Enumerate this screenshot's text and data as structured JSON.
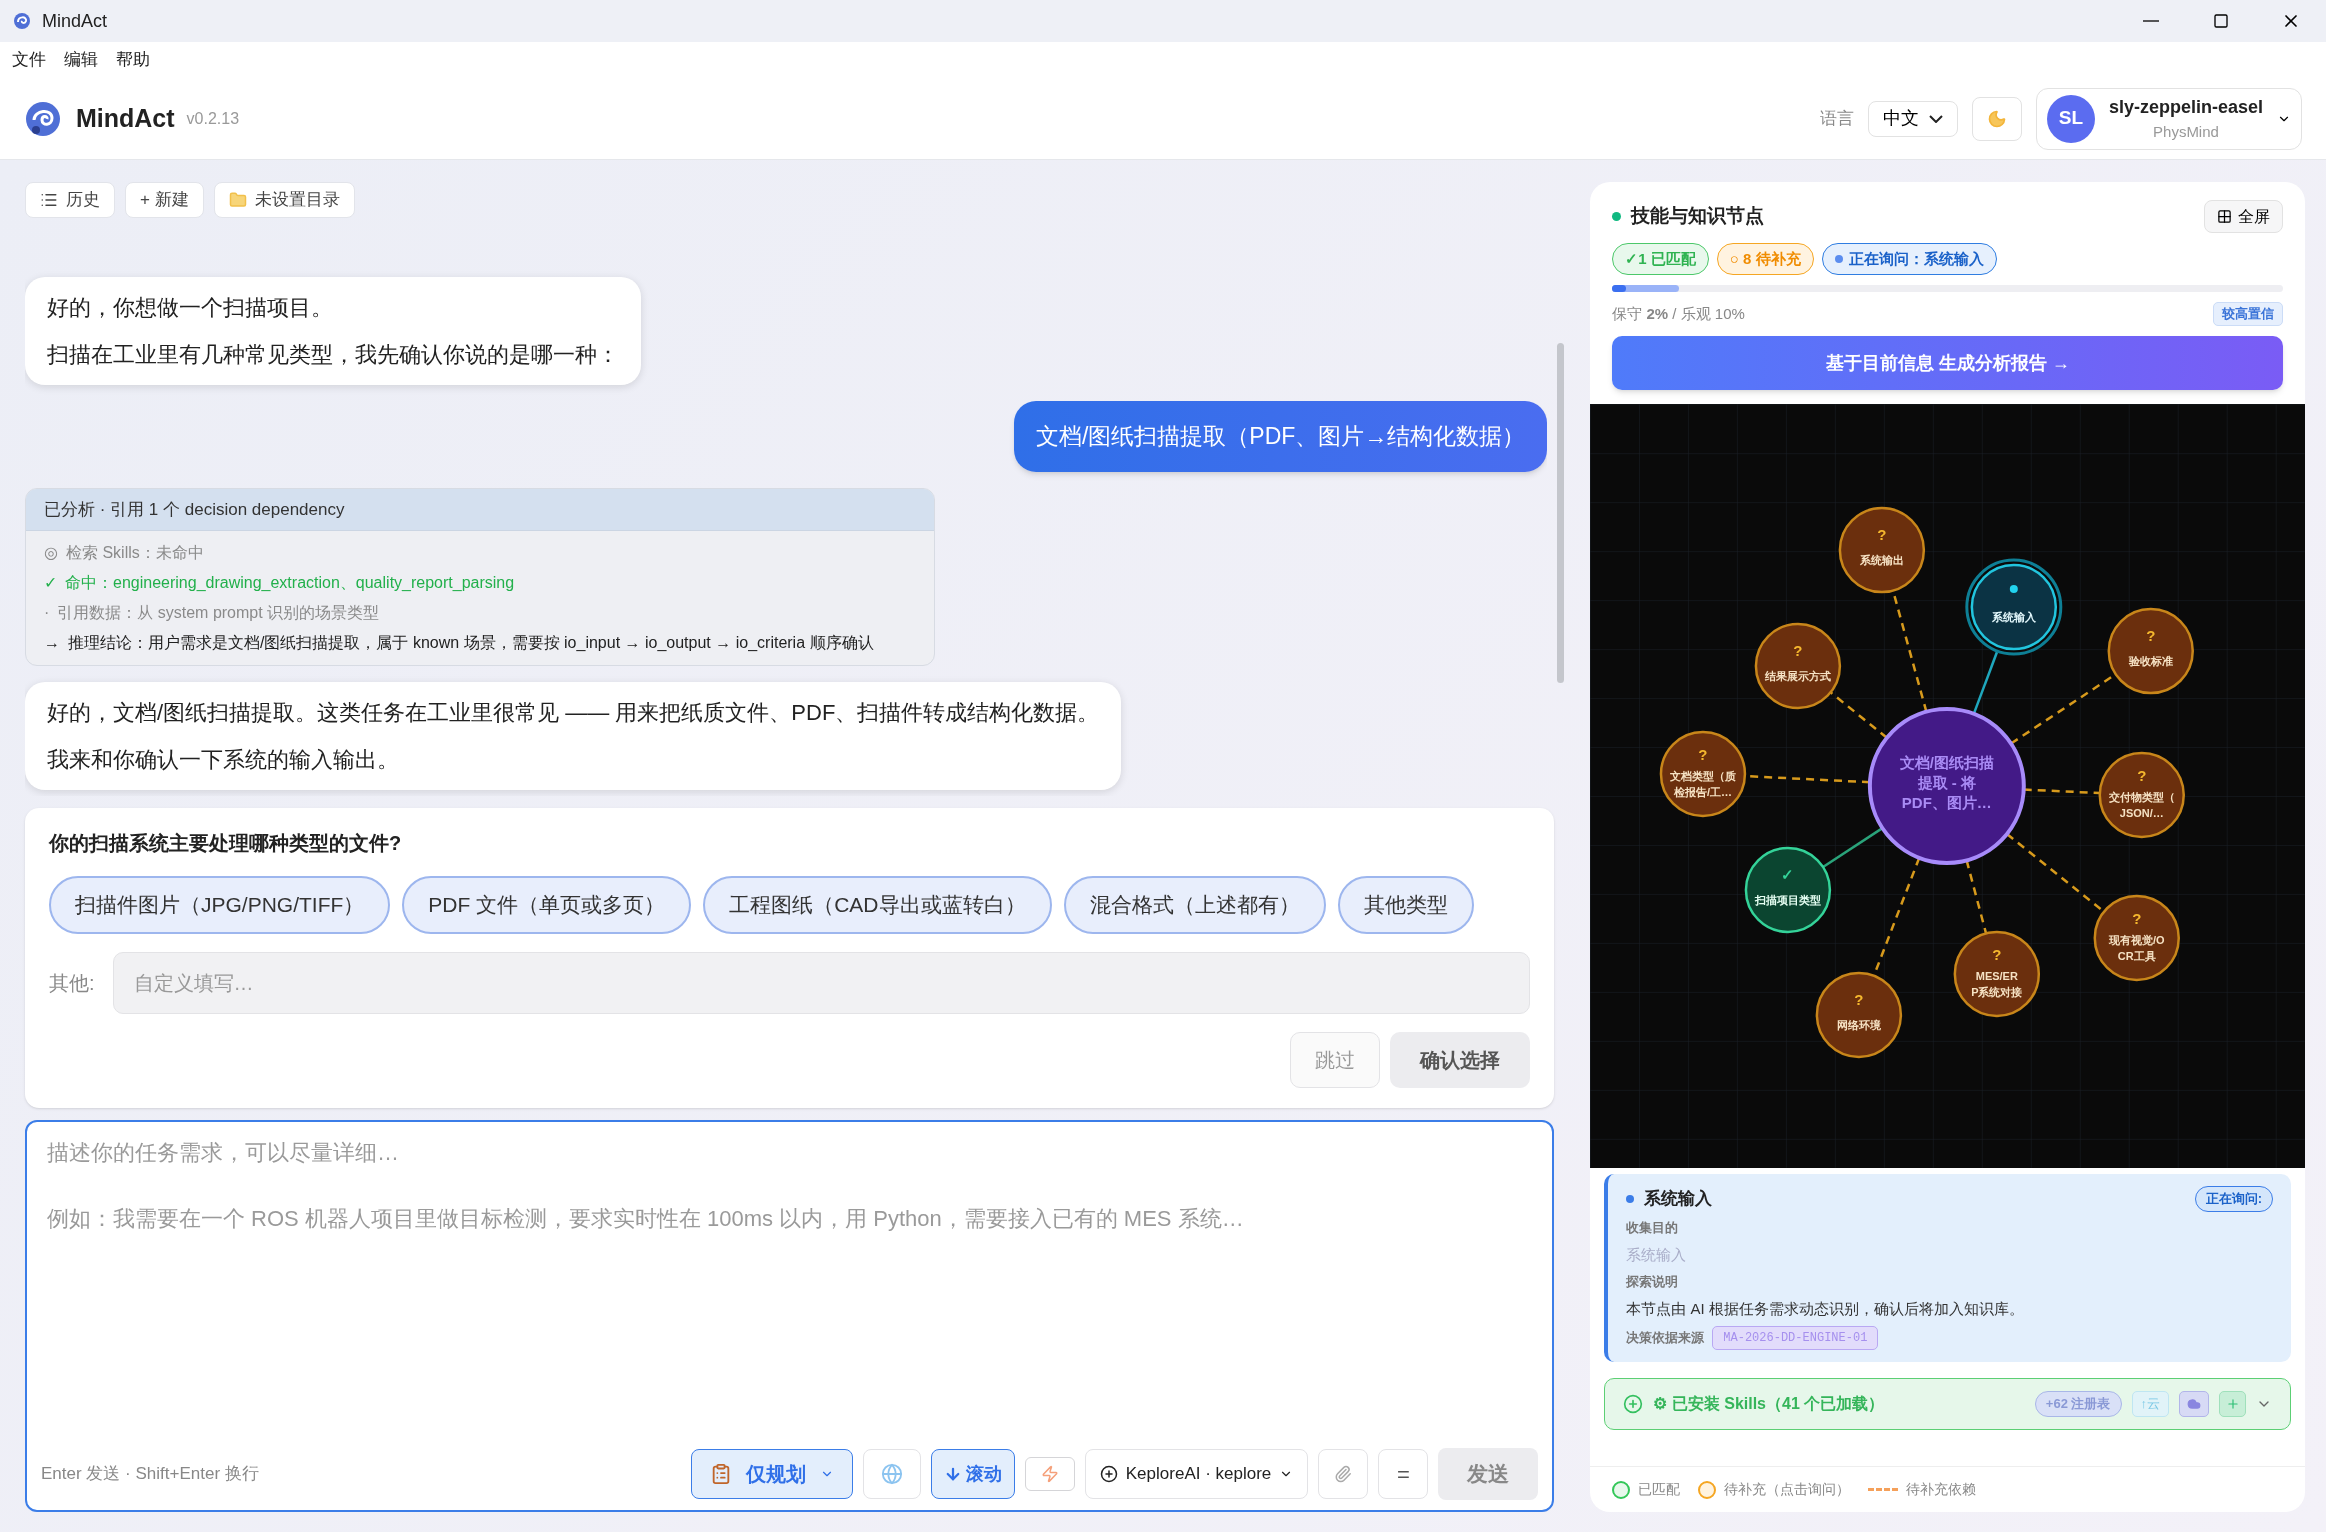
{
  "window": {
    "title": "MindAct"
  },
  "menu": [
    "文件",
    "编辑",
    "帮助"
  ],
  "header": {
    "app_name": "MindAct",
    "version": "v0.2.13",
    "language_label": "语言",
    "language": "中文",
    "user": {
      "initials": "SL",
      "name": "sly-zeppelin-easel",
      "org": "PhysMind"
    }
  },
  "toolbar": [
    {
      "kind": "history",
      "label": "历史"
    },
    {
      "kind": "new",
      "label": "+ 新建"
    },
    {
      "kind": "folder",
      "label": "未设置目录"
    }
  ],
  "chat": [
    {
      "kind": "assistant",
      "paragraphs": [
        "好的，你想做一个扫描项目。",
        "扫描在工业里有几种常见类型，我先确认你说的是哪一种："
      ]
    },
    {
      "kind": "user",
      "paragraphs": [
        "文档/图纸扫描提取（PDF、图片→结构化数据）"
      ]
    },
    {
      "kind": "analysis",
      "title": "已分析 · 引用 1 个 decision dependency",
      "lines": [
        {
          "kind": "search",
          "marker": "◎",
          "text": "检索 Skills：未命中"
        },
        {
          "kind": "hit",
          "marker": "✓",
          "text": "命中：engineering_drawing_extraction、quality_report_parsing"
        },
        {
          "kind": "ref",
          "marker": "·",
          "text": "引用数据：从 system prompt 识别的场景类型"
        },
        {
          "kind": "conclusion",
          "marker": "→",
          "text": "推理结论：用户需求是文档/图纸扫描提取，属于 known 场景，需要按 io_input → io_output → io_criteria 顺序确认"
        }
      ]
    },
    {
      "kind": "assistant",
      "paragraphs": [
        "好的，文档/图纸扫描提取。这类任务在工业里很常见 —— 用来把纸质文件、PDF、扫描件转成结构化数据。",
        "我来和你确认一下系统的输入输出。"
      ]
    }
  ],
  "question": {
    "title": "你的扫描系统主要处理哪种类型的文件?",
    "options": [
      {
        "label": "扫描件图片（JPG/PNG/TIFF）",
        "selected": false
      },
      {
        "label": "PDF 文件（单页或多页）",
        "selected": false
      },
      {
        "label": "工程图纸（CAD导出或蓝转白）",
        "selected": false
      },
      {
        "label": "混合格式（上述都有）",
        "selected": false
      },
      {
        "label": "其他类型",
        "selected": false
      }
    ],
    "other_label": "其他:",
    "other_placeholder": "自定义填写…",
    "skip": "跳过",
    "confirm": "确认选择"
  },
  "composer": {
    "placeholder": "描述你的任务需求，可以尽量详细…\n\n例如：我需要在一个 ROS 机器人项目里做目标检测，要求实时性在 100ms 以内，用 Python，需要接入已有的 MES 系统…",
    "hint": "Enter 发送 · Shift+Enter 换行",
    "mode": "仅规划",
    "scroll": {
      "label": "滚动",
      "on": true
    },
    "model": "KeploreAI · keplore",
    "equal": "=",
    "send": "发送",
    "send_disabled": true
  },
  "panel": {
    "title": "技能与知识节点",
    "fullscreen": "全屏",
    "badges": [
      {
        "kind": "matched",
        "text": "✓1 已匹配"
      },
      {
        "kind": "pending",
        "text": "○ 8 待补充"
      },
      {
        "kind": "asking",
        "text": "正在询问：系统输入"
      }
    ],
    "progress": [
      {
        "kind": "conservative",
        "level": 0.02
      },
      {
        "kind": "optimistic",
        "level": 0.1
      }
    ],
    "reading": "保守 **2%** / 乐观 10%",
    "confidence": "较高置信",
    "report_button": "基于目前信息 生成分析报告 →",
    "graph": {
      "center": {
        "lines": [
          "文档/图纸扫描",
          "提取 - 将",
          "PDF、图片…"
        ]
      },
      "nodes": [
        {
          "kind": "pending",
          "symbol": "?",
          "lines": [
            "系统输出"
          ]
        },
        {
          "kind": "asking",
          "lines": [
            "系统输入"
          ]
        },
        {
          "kind": "pending",
          "symbol": "?",
          "lines": [
            "验收标准"
          ]
        },
        {
          "kind": "pending",
          "symbol": "?",
          "lines": [
            "交付物类型（",
            "JSON/…"
          ]
        },
        {
          "kind": "pending",
          "symbol": "?",
          "lines": [
            "现有视觉/O",
            "CR工具"
          ]
        },
        {
          "kind": "pending",
          "symbol": "?",
          "lines": [
            "MES/ER",
            "P系统对接"
          ]
        },
        {
          "kind": "pending",
          "symbol": "?",
          "lines": [
            "网络环境"
          ]
        },
        {
          "kind": "matched",
          "symbol": "✓",
          "lines": [
            "扫描项目类型"
          ]
        },
        {
          "kind": "pending",
          "symbol": "?",
          "lines": [
            "文档类型（质",
            "检报告/工…"
          ]
        },
        {
          "kind": "pending",
          "symbol": "?",
          "lines": [
            "结果展示方式"
          ]
        }
      ]
    },
    "detail": {
      "title": "系统输入",
      "status": "正在询问:",
      "purpose_label": "收集目的",
      "purpose": "系统输入",
      "explain_label": "探索说明",
      "explain": "本节点由 AI 根据任务需求动态识别，确认后将加入知识库。",
      "source_label": "决策依据来源",
      "source": "MA-2026-DD-ENGINE-01"
    },
    "skills": {
      "label": "⚙ 已安装 Skills（41 个已加载）",
      "registry": "+62 注册表",
      "upload": "↑云"
    },
    "legend": [
      {
        "kind": "matched",
        "label": "已匹配"
      },
      {
        "kind": "pending",
        "label": "待补充（点击询问）"
      },
      {
        "kind": "dependency",
        "label": "待补充依赖"
      }
    ]
  }
}
